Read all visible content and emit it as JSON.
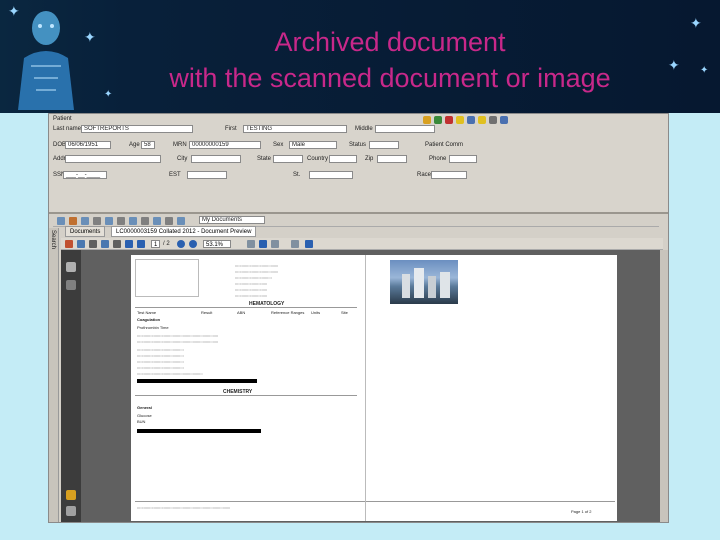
{
  "slide": {
    "title_line1": "Archived document",
    "title_line2": "with the scanned document or image"
  },
  "form": {
    "patient_label": "Patient",
    "last_name_label": "Last name",
    "last_name_value": "SOFTREPORTS",
    "first_label": "First",
    "first_value": "TESTING",
    "middle_label": "Middle",
    "dob_label": "DOB",
    "dob_value": "06/06/1951",
    "age_label": "Age",
    "age_value": "58",
    "mrn_label": "MRN",
    "mrn_value": "00000000159",
    "sex_label": "Sex",
    "sex_value": "Male",
    "status_label": "Status",
    "patient_comm_label": "Patient Comm",
    "addr_label": "Addr",
    "city_label": "City",
    "state_label": "State",
    "country_label": "Country",
    "zip_label": "Zip",
    "phone_label": "Phone",
    "ssn_label": "SSN",
    "ssn_value": "___-__-____",
    "est_label": "EST",
    "st_label": "St.",
    "race_label": "Race"
  },
  "viewer": {
    "search_label": "Search",
    "folder_value": "My Documents",
    "tab_documents": "Documents",
    "tab_preview": "LC0000003159 Collated 2012 - Document Preview",
    "page_current": "1",
    "page_total": "/ 2",
    "zoom_value": "53.1%"
  },
  "report": {
    "hematology": "HEMATOLOGY",
    "chemistry": "CHEMISTRY",
    "col_test": "Test Name",
    "col_result": "Result",
    "col_abn": "ABN",
    "col_range": "Reference Ranges",
    "col_units": "Units",
    "col_site": "Site",
    "coagulation": "Coagulation",
    "prothrombin": "Prothrombin Time",
    "general": "General",
    "glucose": "Glucose",
    "bun": "BUN",
    "footer_page": "Page 1 of 2"
  },
  "colors": {
    "title": "#c8288a",
    "banner": "#061830",
    "background": "#c4ecf6"
  }
}
